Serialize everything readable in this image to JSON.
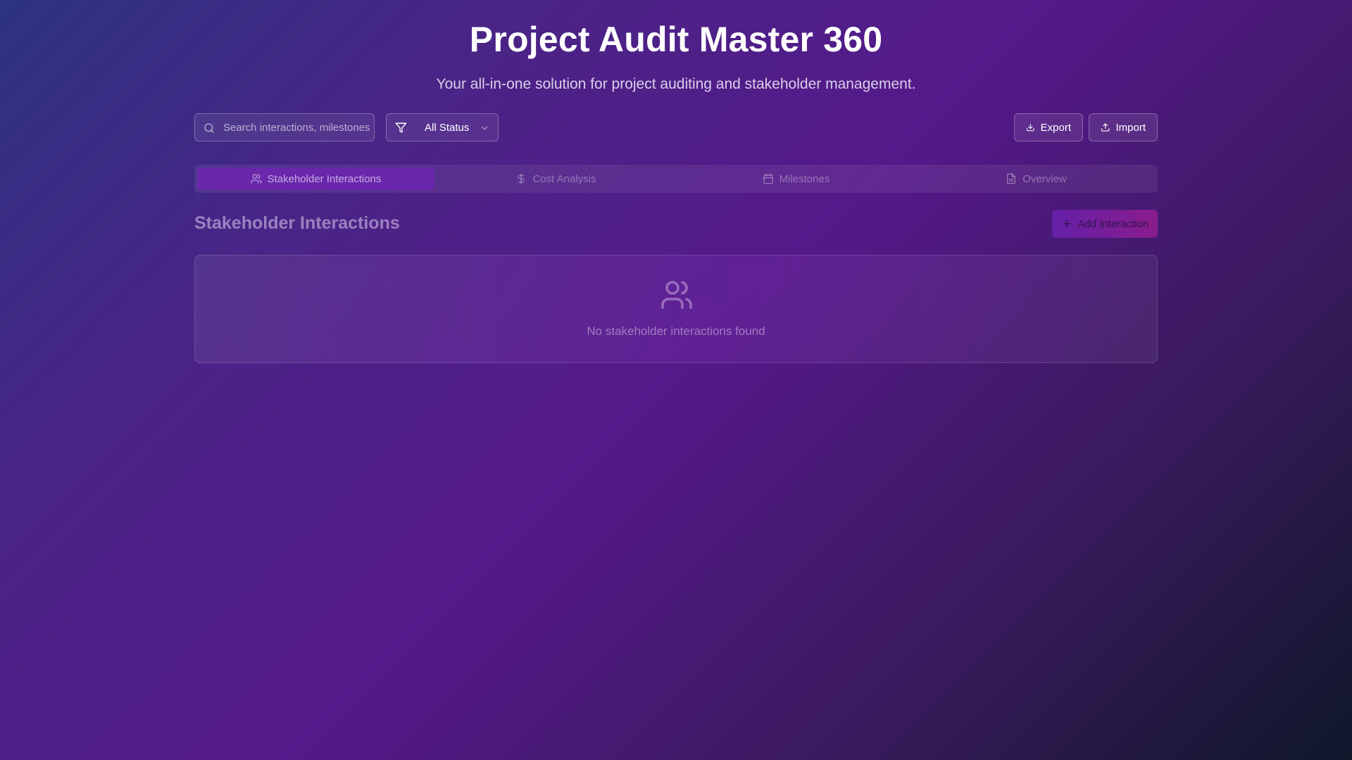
{
  "header": {
    "title": "Project Audit Master 360",
    "subtitle": "Your all-in-one solution for project auditing and stakeholder management."
  },
  "toolbar": {
    "search_placeholder": "Search interactions, milestones...",
    "search_icon": "search-icon",
    "status_filter": {
      "icon": "filter-icon",
      "selected": "All Status"
    },
    "export_label": "Export",
    "import_label": "Import"
  },
  "tabs": [
    {
      "label": "Stakeholder Interactions",
      "icon": "users-icon",
      "active": true
    },
    {
      "label": "Cost Analysis",
      "icon": "dollar-icon",
      "active": false
    },
    {
      "label": "Milestones",
      "icon": "calendar-icon",
      "active": false
    },
    {
      "label": "Overview",
      "icon": "document-icon",
      "active": false
    }
  ],
  "section": {
    "title": "Stakeholder Interactions",
    "add_label": "Add Interaction",
    "empty_message": "No stakeholder interactions found"
  },
  "colors": {
    "active_tab": "#6a27ac",
    "add_button_start": "#6420a8",
    "add_button_end": "#8a1c8c"
  }
}
